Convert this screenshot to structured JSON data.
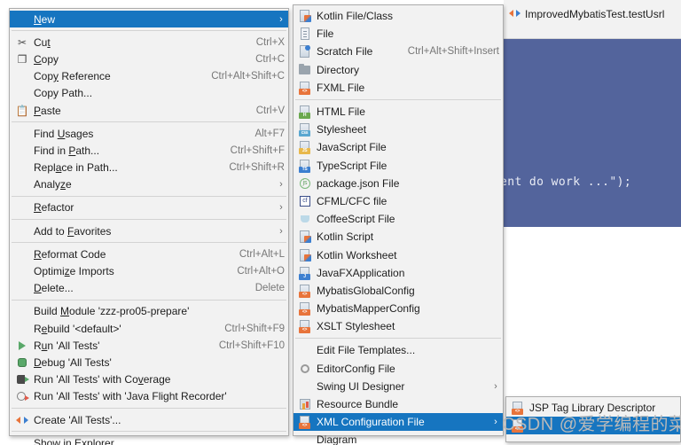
{
  "editor": {
    "tab_label": "ImprovedMybatisTest.testUsrl",
    "tab_icon": "run-config-icon",
    "code_fragment": "ent do work ...\");",
    "selection_color": "#53649c"
  },
  "watermark": "CSDN @爱学编程的菜鸟",
  "context_menu": {
    "name": "project-context-menu",
    "items": [
      {
        "label": "New",
        "mnemonic": "N",
        "accel": "",
        "icon": "",
        "submenu": true,
        "selected": true
      },
      {
        "type": "separator"
      },
      {
        "label": "Cut",
        "mnemonic": "t",
        "accel": "Ctrl+X",
        "icon": "scissors-icon",
        "submenu": false
      },
      {
        "label": "Copy",
        "mnemonic": "C",
        "accel": "Ctrl+C",
        "icon": "copy-icon",
        "submenu": false
      },
      {
        "label": "Copy Reference",
        "mnemonic": "y",
        "accel": "Ctrl+Alt+Shift+C",
        "icon": "",
        "submenu": false
      },
      {
        "label": "Copy Path...",
        "mnemonic": "",
        "accel": "",
        "icon": "",
        "submenu": false
      },
      {
        "label": "Paste",
        "mnemonic": "P",
        "accel": "Ctrl+V",
        "icon": "clipboard-icon",
        "submenu": false
      },
      {
        "type": "separator"
      },
      {
        "label": "Find Usages",
        "mnemonic": "U",
        "accel": "Alt+F7",
        "icon": "",
        "submenu": false
      },
      {
        "label": "Find in Path...",
        "mnemonic": "P",
        "accel": "Ctrl+Shift+F",
        "icon": "",
        "submenu": false
      },
      {
        "label": "Replace in Path...",
        "mnemonic": "a",
        "accel": "Ctrl+Shift+R",
        "icon": "",
        "submenu": false
      },
      {
        "label": "Analyze",
        "mnemonic": "z",
        "accel": "",
        "icon": "",
        "submenu": true
      },
      {
        "type": "separator"
      },
      {
        "label": "Refactor",
        "mnemonic": "R",
        "accel": "",
        "icon": "",
        "submenu": true
      },
      {
        "type": "separator"
      },
      {
        "label": "Add to Favorites",
        "mnemonic": "F",
        "accel": "",
        "icon": "",
        "submenu": true
      },
      {
        "type": "separator"
      },
      {
        "label": "Reformat Code",
        "mnemonic": "R",
        "accel": "Ctrl+Alt+L",
        "icon": "",
        "submenu": false
      },
      {
        "label": "Optimize Imports",
        "mnemonic": "z",
        "accel": "Ctrl+Alt+O",
        "icon": "",
        "submenu": false
      },
      {
        "label": "Delete...",
        "mnemonic": "D",
        "accel": "Delete",
        "icon": "",
        "submenu": false
      },
      {
        "type": "separator"
      },
      {
        "label": "Build Module 'zzz-pro05-prepare'",
        "mnemonic": "M",
        "accel": "",
        "icon": "",
        "submenu": false
      },
      {
        "label": "Rebuild '<default>'",
        "mnemonic": "e",
        "accel": "Ctrl+Shift+F9",
        "icon": "",
        "submenu": false
      },
      {
        "label": "Run 'All Tests'",
        "mnemonic": "u",
        "accel": "Ctrl+Shift+F10",
        "icon": "run-icon",
        "submenu": false
      },
      {
        "label": "Debug 'All Tests'",
        "mnemonic": "D",
        "accel": "",
        "icon": "debug-icon",
        "submenu": false
      },
      {
        "label": "Run 'All Tests' with Coverage",
        "mnemonic": "v",
        "accel": "",
        "icon": "coverage-icon",
        "submenu": false
      },
      {
        "label": "Run 'All Tests' with 'Java Flight Recorder'",
        "mnemonic": "",
        "accel": "",
        "icon": "flight-recorder-icon",
        "submenu": false
      },
      {
        "type": "separator"
      },
      {
        "label": "Create 'All Tests'...",
        "mnemonic": "",
        "accel": "",
        "icon": "run-config-icon",
        "submenu": false
      },
      {
        "type": "separator"
      },
      {
        "label": "Show in Explorer",
        "mnemonic": "",
        "accel": "",
        "icon": "",
        "submenu": false
      }
    ]
  },
  "new_submenu": {
    "name": "new-submenu",
    "items": [
      {
        "label": "Kotlin File/Class",
        "accel": "",
        "icon": "kotlin-file-icon",
        "submenu": false
      },
      {
        "label": "File",
        "accel": "",
        "icon": "file-icon",
        "submenu": false
      },
      {
        "label": "Scratch File",
        "accel": "Ctrl+Alt+Shift+Insert",
        "icon": "scratch-file-icon",
        "submenu": false
      },
      {
        "label": "Directory",
        "accel": "",
        "icon": "folder-icon",
        "submenu": false
      },
      {
        "label": "FXML File",
        "accel": "",
        "icon": "fxml-file-icon",
        "submenu": false
      },
      {
        "type": "separator"
      },
      {
        "label": "HTML File",
        "accel": "",
        "icon": "html-file-icon",
        "submenu": false
      },
      {
        "label": "Stylesheet",
        "accel": "",
        "icon": "css-file-icon",
        "submenu": false
      },
      {
        "label": "JavaScript File",
        "accel": "",
        "icon": "js-file-icon",
        "submenu": false
      },
      {
        "label": "TypeScript File",
        "accel": "",
        "icon": "ts-file-icon",
        "submenu": false
      },
      {
        "label": "package.json File",
        "accel": "",
        "icon": "npm-icon",
        "submenu": false
      },
      {
        "label": "CFML/CFC file",
        "accel": "",
        "icon": "cfml-icon",
        "submenu": false
      },
      {
        "label": "CoffeeScript File",
        "accel": "",
        "icon": "coffeescript-icon",
        "submenu": false
      },
      {
        "label": "Kotlin Script",
        "accel": "",
        "icon": "kotlin-script-icon",
        "submenu": false
      },
      {
        "label": "Kotlin Worksheet",
        "accel": "",
        "icon": "kotlin-worksheet-icon",
        "submenu": false
      },
      {
        "label": "JavaFXApplication",
        "accel": "",
        "icon": "javafx-icon",
        "submenu": false
      },
      {
        "label": "MybatisGlobalConfig",
        "accel": "",
        "icon": "xml-file-icon",
        "submenu": false
      },
      {
        "label": "MybatisMapperConfig",
        "accel": "",
        "icon": "xml-file-icon",
        "submenu": false
      },
      {
        "label": "XSLT Stylesheet",
        "accel": "",
        "icon": "xml-file-icon",
        "submenu": false
      },
      {
        "type": "separator"
      },
      {
        "label": "Edit File Templates...",
        "accel": "",
        "icon": "",
        "submenu": false
      },
      {
        "label": "EditorConfig File",
        "accel": "",
        "icon": "gear-icon",
        "submenu": false
      },
      {
        "label": "Swing UI Designer",
        "accel": "",
        "icon": "",
        "submenu": true
      },
      {
        "label": "Resource Bundle",
        "accel": "",
        "icon": "resource-bundle-icon",
        "submenu": false
      },
      {
        "label": "XML Configuration File",
        "accel": "",
        "icon": "xml-file-icon",
        "submenu": true,
        "selected": true
      },
      {
        "label": "Diagram",
        "accel": "",
        "icon": "",
        "submenu": false
      }
    ]
  },
  "xml_submenu": {
    "name": "xml-configuration-file-submenu",
    "items": [
      {
        "label": "JSP Tag Library Descriptor",
        "accel": "",
        "icon": "xml-file-icon",
        "submenu": false
      },
      {
        "label": "",
        "accel": "",
        "icon": "xml-file-icon",
        "submenu": false,
        "selected": true
      }
    ]
  },
  "colors": {
    "menu_bg": "#f2f2f2",
    "menu_border": "#adadad",
    "highlight": "#1675c0",
    "accel_text": "#777777",
    "text": "#1d1d1d"
  }
}
